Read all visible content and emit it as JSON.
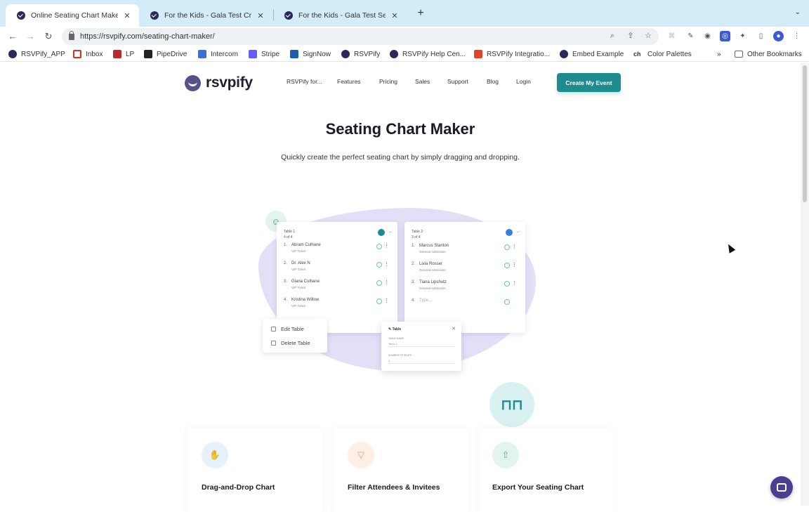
{
  "browser": {
    "tabs": [
      {
        "title": "Online Seating Chart Maker - R",
        "active": true
      },
      {
        "title": "For the Kids - Gala Test Create",
        "active": false
      },
      {
        "title": "For the Kids - Gala Test Seatin",
        "active": false
      }
    ],
    "url": "https://rsvpify.com/seating-chart-maker/",
    "bookmarks": [
      {
        "label": "RSVPify_APP",
        "icon": "rsvpify-icon",
        "color": "#2a2a5a"
      },
      {
        "label": "Inbox",
        "icon": "gmail-icon",
        "color": "#d93025"
      },
      {
        "label": "LP",
        "icon": "lp-icon",
        "color": "#c0262d"
      },
      {
        "label": "PipeDrive",
        "icon": "pipedrive-icon",
        "color": "#222"
      },
      {
        "label": "Intercom",
        "icon": "intercom-icon",
        "color": "#3b6fd8"
      },
      {
        "label": "Stripe",
        "icon": "stripe-icon",
        "color": "#635bff"
      },
      {
        "label": "SignNow",
        "icon": "signnow-icon",
        "color": "#1b5fb0"
      },
      {
        "label": "RSVPify",
        "icon": "rsvpify-icon",
        "color": "#2a2a5a"
      },
      {
        "label": "RSVPify Help Cen...",
        "icon": "rsvpify-icon",
        "color": "#2a2a5a"
      },
      {
        "label": "RSVPify Integratio...",
        "icon": "integration-icon",
        "color": "#e2432a"
      },
      {
        "label": "Embed Example",
        "icon": "rsvpify-icon",
        "color": "#2a2a5a"
      },
      {
        "label": "Color Palettes",
        "icon": "ch-icon",
        "color": "#333"
      }
    ],
    "more_bookmarks": "»",
    "other_bookmarks": "Other Bookmarks"
  },
  "site": {
    "logo_text": "rsvpify",
    "nav": [
      "RSVPify for...",
      "Features",
      "Pricing",
      "Sales",
      "Support",
      "Blog",
      "Login"
    ],
    "cta_label": "Create My Event",
    "brand_color": "#1e8b8f"
  },
  "hero": {
    "title": "Seating Chart Maker",
    "subtitle": "Quickly create the perfect seating chart by simply dragging and dropping."
  },
  "illustration": {
    "table1": {
      "name": "Table 1",
      "count": "4 of 4",
      "dot_color": "#1e8b8f",
      "guests": [
        {
          "num": "1.",
          "name": "Abram Culhane",
          "ticket": "VIP Ticket"
        },
        {
          "num": "2.",
          "name": "Dr. Alex N",
          "ticket": "VIP Ticket"
        },
        {
          "num": "3.",
          "name": "Giana Culhane",
          "ticket": "VIP Ticket"
        },
        {
          "num": "4.",
          "name": "Kristina Willow",
          "ticket": "VIP Ticket"
        }
      ]
    },
    "table2": {
      "name": "Table 2",
      "count": "3 of 4",
      "dot_color": "#3b7ddd",
      "guests": [
        {
          "num": "1.",
          "name": "Marcus Stanton",
          "ticket": "General Admission"
        },
        {
          "num": "2.",
          "name": "Livia Rosser",
          "ticket": "General Admission"
        },
        {
          "num": "3.",
          "name": "Tiana Lipshutz",
          "ticket": "General Admission"
        },
        {
          "num": "4.",
          "name": "Type...",
          "ticket": ""
        }
      ]
    },
    "menu": [
      "Edit Table",
      "Delete Table"
    ],
    "form": {
      "title": "Table",
      "name_label": "TABLE NAME",
      "name_value": "Table 1",
      "seats_label": "NUMBER OF SEATS",
      "seats_value": "4"
    }
  },
  "features": [
    {
      "title": "Drag-and-Drop Chart",
      "icon": "hand-icon",
      "bg": "#e6f1fb",
      "fg": "#7aa4cf"
    },
    {
      "title": "Filter Attendees & Invitees",
      "icon": "filter-icon",
      "bg": "#fdeee6",
      "fg": "#e9a27c"
    },
    {
      "title": "Export Your Seating Chart",
      "icon": "export-icon",
      "bg": "#e3f4ef",
      "fg": "#5aa98e"
    }
  ]
}
